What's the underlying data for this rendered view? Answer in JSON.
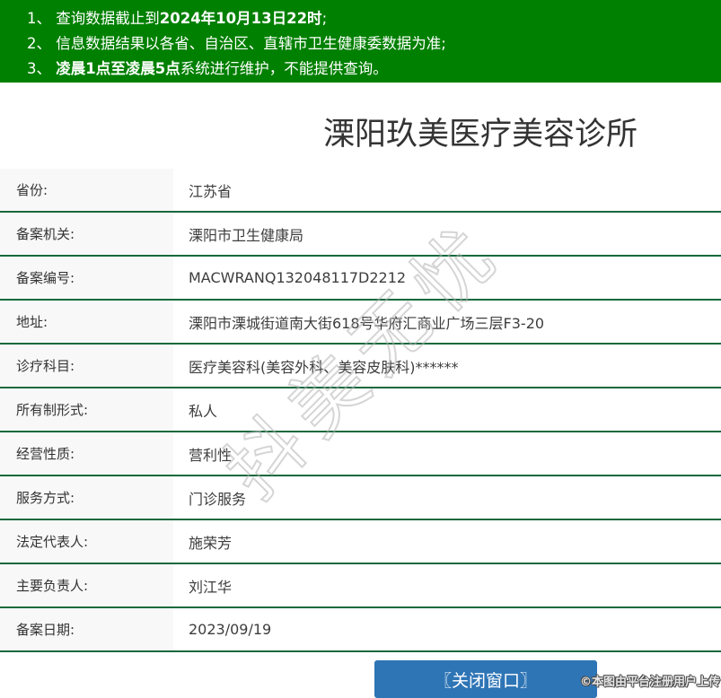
{
  "notice": {
    "lines": [
      {
        "pre": "1、 查询数据截止到",
        "bold": "2024年10月13日22时",
        "post": ";"
      },
      {
        "pre": "2、 信息数据结果以各省、自治区、直辖市卫生健康委数据为准;",
        "bold": "",
        "post": ""
      },
      {
        "pre": "3、 ",
        "bold": "凌晨1点至凌晨5点",
        "post": "系统进行维护，不能提供查询。"
      }
    ]
  },
  "title": "溧阳玖美医疗美容诊所",
  "table": {
    "rows": [
      {
        "label": "省份:",
        "value": "江苏省"
      },
      {
        "label": "备案机关:",
        "value": "溧阳市卫生健康局"
      },
      {
        "label": "备案编号:",
        "value": "MACWRANQ132048117D2212"
      },
      {
        "label": "地址:",
        "value": "溧阳市溧城街道南大街618号华府汇商业广场三层F3-20"
      },
      {
        "label": "诊疗科目:",
        "value": "医疗美容科(美容外科、美容皮肤科)******"
      },
      {
        "label": "所有制形式:",
        "value": "私人"
      },
      {
        "label": "经营性质:",
        "value": "营利性"
      },
      {
        "label": "服务方式:",
        "value": "门诊服务"
      },
      {
        "label": "法定代表人:",
        "value": "施荣芳"
      },
      {
        "label": "主要负责人:",
        "value": "刘江华"
      },
      {
        "label": "备案日期:",
        "value": "2023/09/19"
      }
    ]
  },
  "close_button": {
    "label": "〖关闭窗口〗"
  },
  "watermarks": {
    "diagonal": "抖美无忧",
    "corner": "©本图由平台注册用户上传"
  },
  "colors": {
    "notice_bg": "#008000",
    "divider_green": "#15693c",
    "button_blue": "#2e75b6",
    "label_bg": "#f8f8f8"
  }
}
